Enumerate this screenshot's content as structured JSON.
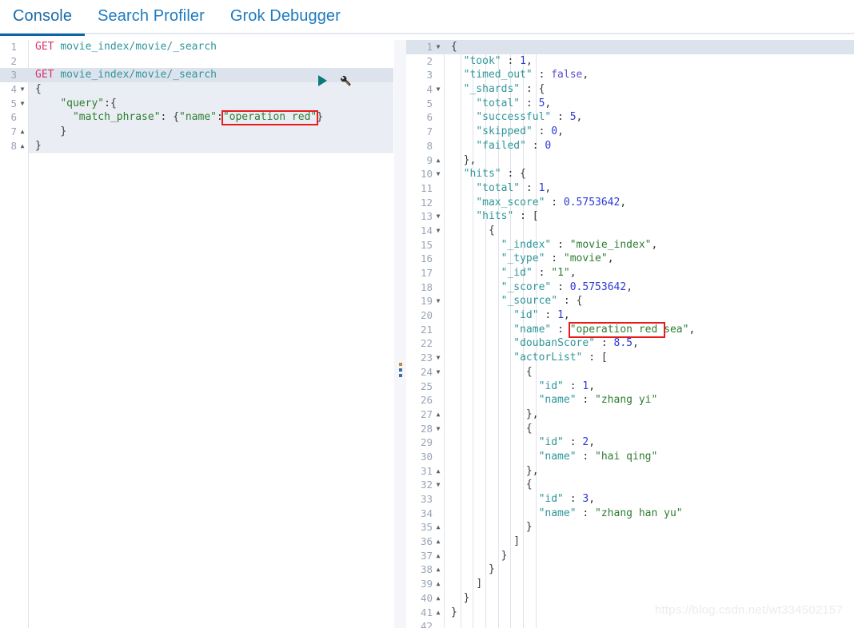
{
  "tabs": [
    {
      "label": "Console",
      "active": true
    },
    {
      "label": "Search Profiler",
      "active": false
    },
    {
      "label": "Grok Debugger",
      "active": false
    }
  ],
  "colors": {
    "accent": "#0b63a8",
    "tab_text": "#1f7bbf",
    "method": "#d6336c",
    "url": "#2f9599",
    "key": "#2f9599",
    "string": "#2e7d32",
    "number": "#2b3ad6",
    "boolean": "#5b4fcf",
    "highlight_line": "#dde3ec",
    "request_block_bg": "#eaeef4",
    "annotation_box": "#e81b1b",
    "watermark": "#ececec"
  },
  "request_editor": {
    "name": "console-request-editor",
    "highlight_line": 3,
    "lines": [
      {
        "n": 1,
        "fold": "",
        "text": "GET movie_index/movie/_search",
        "tokens": [
          {
            "t": "method",
            "v": "GET"
          },
          {
            "t": "punc",
            "v": " "
          },
          {
            "t": "url",
            "v": "movie_index/movie/_search"
          }
        ]
      },
      {
        "n": 2,
        "fold": "",
        "text": "",
        "tokens": []
      },
      {
        "n": 3,
        "fold": "",
        "text": "GET movie_index/movie/_search",
        "tokens": [
          {
            "t": "method",
            "v": "GET"
          },
          {
            "t": "punc",
            "v": " "
          },
          {
            "t": "url",
            "v": "movie_index/movie/_search"
          }
        ]
      },
      {
        "n": 4,
        "fold": "down",
        "text": "{",
        "tokens": [
          {
            "t": "brace",
            "v": "{"
          }
        ]
      },
      {
        "n": 5,
        "fold": "down",
        "text": "    \"query\":{",
        "tokens": [
          {
            "t": "punc",
            "v": "    "
          },
          {
            "t": "str",
            "v": "\"query\""
          },
          {
            "t": "punc",
            "v": ":"
          },
          {
            "t": "brace",
            "v": "{"
          }
        ]
      },
      {
        "n": 6,
        "fold": "",
        "text": "      \"match_phrase\": {\"name\":\"operation red\"}",
        "tokens": [
          {
            "t": "punc",
            "v": "      "
          },
          {
            "t": "str",
            "v": "\"match_phrase\""
          },
          {
            "t": "punc",
            "v": ": "
          },
          {
            "t": "brace",
            "v": "{"
          },
          {
            "t": "str",
            "v": "\"name\""
          },
          {
            "t": "punc",
            "v": ":"
          },
          {
            "t": "str",
            "v": "\"operation red\""
          },
          {
            "t": "brace",
            "v": "}"
          }
        ]
      },
      {
        "n": 7,
        "fold": "up",
        "text": "    }",
        "tokens": [
          {
            "t": "punc",
            "v": "    "
          },
          {
            "t": "brace",
            "v": "}"
          }
        ]
      },
      {
        "n": 8,
        "fold": "up",
        "text": "}",
        "tokens": [
          {
            "t": "brace",
            "v": "}"
          }
        ]
      }
    ],
    "actions": {
      "play_label": "Click to send request",
      "wrench_label": "Open documentation / auto indent"
    },
    "annotation": {
      "text": "operation red"
    }
  },
  "response_editor": {
    "name": "console-response-editor",
    "highlight_line": 1,
    "lines": [
      {
        "n": 1,
        "fold": "down",
        "indent": 0,
        "tokens": [
          {
            "t": "brace",
            "v": "{"
          }
        ]
      },
      {
        "n": 2,
        "fold": "",
        "indent": 1,
        "tokens": [
          {
            "t": "key",
            "v": "\"took\""
          },
          {
            "t": "punc",
            "v": " : "
          },
          {
            "t": "num",
            "v": "1"
          },
          {
            "t": "punc",
            "v": ","
          }
        ]
      },
      {
        "n": 3,
        "fold": "",
        "indent": 1,
        "tokens": [
          {
            "t": "key",
            "v": "\"timed_out\""
          },
          {
            "t": "punc",
            "v": " : "
          },
          {
            "t": "bool",
            "v": "false"
          },
          {
            "t": "punc",
            "v": ","
          }
        ]
      },
      {
        "n": 4,
        "fold": "down",
        "indent": 1,
        "tokens": [
          {
            "t": "key",
            "v": "\"_shards\""
          },
          {
            "t": "punc",
            "v": " : "
          },
          {
            "t": "brace",
            "v": "{"
          }
        ]
      },
      {
        "n": 5,
        "fold": "",
        "indent": 2,
        "tokens": [
          {
            "t": "key",
            "v": "\"total\""
          },
          {
            "t": "punc",
            "v": " : "
          },
          {
            "t": "num",
            "v": "5"
          },
          {
            "t": "punc",
            "v": ","
          }
        ]
      },
      {
        "n": 6,
        "fold": "",
        "indent": 2,
        "tokens": [
          {
            "t": "key",
            "v": "\"successful\""
          },
          {
            "t": "punc",
            "v": " : "
          },
          {
            "t": "num",
            "v": "5"
          },
          {
            "t": "punc",
            "v": ","
          }
        ]
      },
      {
        "n": 7,
        "fold": "",
        "indent": 2,
        "tokens": [
          {
            "t": "key",
            "v": "\"skipped\""
          },
          {
            "t": "punc",
            "v": " : "
          },
          {
            "t": "num",
            "v": "0"
          },
          {
            "t": "punc",
            "v": ","
          }
        ]
      },
      {
        "n": 8,
        "fold": "",
        "indent": 2,
        "tokens": [
          {
            "t": "key",
            "v": "\"failed\""
          },
          {
            "t": "punc",
            "v": " : "
          },
          {
            "t": "num",
            "v": "0"
          }
        ]
      },
      {
        "n": 9,
        "fold": "up",
        "indent": 1,
        "tokens": [
          {
            "t": "brace",
            "v": "}"
          },
          {
            "t": "punc",
            "v": ","
          }
        ]
      },
      {
        "n": 10,
        "fold": "down",
        "indent": 1,
        "tokens": [
          {
            "t": "key",
            "v": "\"hits\""
          },
          {
            "t": "punc",
            "v": " : "
          },
          {
            "t": "brace",
            "v": "{"
          }
        ]
      },
      {
        "n": 11,
        "fold": "",
        "indent": 2,
        "tokens": [
          {
            "t": "key",
            "v": "\"total\""
          },
          {
            "t": "punc",
            "v": " : "
          },
          {
            "t": "num",
            "v": "1"
          },
          {
            "t": "punc",
            "v": ","
          }
        ]
      },
      {
        "n": 12,
        "fold": "",
        "indent": 2,
        "tokens": [
          {
            "t": "key",
            "v": "\"max_score\""
          },
          {
            "t": "punc",
            "v": " : "
          },
          {
            "t": "num",
            "v": "0.5753642"
          },
          {
            "t": "punc",
            "v": ","
          }
        ]
      },
      {
        "n": 13,
        "fold": "down",
        "indent": 2,
        "tokens": [
          {
            "t": "key",
            "v": "\"hits\""
          },
          {
            "t": "punc",
            "v": " : "
          },
          {
            "t": "brace",
            "v": "["
          }
        ]
      },
      {
        "n": 14,
        "fold": "down",
        "indent": 3,
        "tokens": [
          {
            "t": "brace",
            "v": "{"
          }
        ]
      },
      {
        "n": 15,
        "fold": "",
        "indent": 4,
        "tokens": [
          {
            "t": "key",
            "v": "\"_index\""
          },
          {
            "t": "punc",
            "v": " : "
          },
          {
            "t": "str",
            "v": "\"movie_index\""
          },
          {
            "t": "punc",
            "v": ","
          }
        ]
      },
      {
        "n": 16,
        "fold": "",
        "indent": 4,
        "tokens": [
          {
            "t": "key",
            "v": "\"_type\""
          },
          {
            "t": "punc",
            "v": " : "
          },
          {
            "t": "str",
            "v": "\"movie\""
          },
          {
            "t": "punc",
            "v": ","
          }
        ]
      },
      {
        "n": 17,
        "fold": "",
        "indent": 4,
        "tokens": [
          {
            "t": "key",
            "v": "\"_id\""
          },
          {
            "t": "punc",
            "v": " : "
          },
          {
            "t": "str",
            "v": "\"1\""
          },
          {
            "t": "punc",
            "v": ","
          }
        ]
      },
      {
        "n": 18,
        "fold": "",
        "indent": 4,
        "tokens": [
          {
            "t": "key",
            "v": "\"_score\""
          },
          {
            "t": "punc",
            "v": " : "
          },
          {
            "t": "num",
            "v": "0.5753642"
          },
          {
            "t": "punc",
            "v": ","
          }
        ]
      },
      {
        "n": 19,
        "fold": "down",
        "indent": 4,
        "tokens": [
          {
            "t": "key",
            "v": "\"_source\""
          },
          {
            "t": "punc",
            "v": " : "
          },
          {
            "t": "brace",
            "v": "{"
          }
        ]
      },
      {
        "n": 20,
        "fold": "",
        "indent": 5,
        "tokens": [
          {
            "t": "key",
            "v": "\"id\""
          },
          {
            "t": "punc",
            "v": " : "
          },
          {
            "t": "num",
            "v": "1"
          },
          {
            "t": "punc",
            "v": ","
          }
        ]
      },
      {
        "n": 21,
        "fold": "",
        "indent": 5,
        "tokens": [
          {
            "t": "key",
            "v": "\"name\""
          },
          {
            "t": "punc",
            "v": " : "
          },
          {
            "t": "str",
            "v": "\"operation red sea\""
          },
          {
            "t": "punc",
            "v": ","
          }
        ]
      },
      {
        "n": 22,
        "fold": "",
        "indent": 5,
        "tokens": [
          {
            "t": "key",
            "v": "\"doubanScore\""
          },
          {
            "t": "punc",
            "v": " : "
          },
          {
            "t": "num",
            "v": "8.5"
          },
          {
            "t": "punc",
            "v": ","
          }
        ]
      },
      {
        "n": 23,
        "fold": "down",
        "indent": 5,
        "tokens": [
          {
            "t": "key",
            "v": "\"actorList\""
          },
          {
            "t": "punc",
            "v": " : "
          },
          {
            "t": "brace",
            "v": "["
          }
        ]
      },
      {
        "n": 24,
        "fold": "down",
        "indent": 6,
        "tokens": [
          {
            "t": "brace",
            "v": "{"
          }
        ]
      },
      {
        "n": 25,
        "fold": "",
        "indent": 7,
        "tokens": [
          {
            "t": "key",
            "v": "\"id\""
          },
          {
            "t": "punc",
            "v": " : "
          },
          {
            "t": "num",
            "v": "1"
          },
          {
            "t": "punc",
            "v": ","
          }
        ]
      },
      {
        "n": 26,
        "fold": "",
        "indent": 7,
        "tokens": [
          {
            "t": "key",
            "v": "\"name\""
          },
          {
            "t": "punc",
            "v": " : "
          },
          {
            "t": "str",
            "v": "\"zhang yi\""
          }
        ]
      },
      {
        "n": 27,
        "fold": "up",
        "indent": 6,
        "tokens": [
          {
            "t": "brace",
            "v": "}"
          },
          {
            "t": "punc",
            "v": ","
          }
        ]
      },
      {
        "n": 28,
        "fold": "down",
        "indent": 6,
        "tokens": [
          {
            "t": "brace",
            "v": "{"
          }
        ]
      },
      {
        "n": 29,
        "fold": "",
        "indent": 7,
        "tokens": [
          {
            "t": "key",
            "v": "\"id\""
          },
          {
            "t": "punc",
            "v": " : "
          },
          {
            "t": "num",
            "v": "2"
          },
          {
            "t": "punc",
            "v": ","
          }
        ]
      },
      {
        "n": 30,
        "fold": "",
        "indent": 7,
        "tokens": [
          {
            "t": "key",
            "v": "\"name\""
          },
          {
            "t": "punc",
            "v": " : "
          },
          {
            "t": "str",
            "v": "\"hai qing\""
          }
        ]
      },
      {
        "n": 31,
        "fold": "up",
        "indent": 6,
        "tokens": [
          {
            "t": "brace",
            "v": "}"
          },
          {
            "t": "punc",
            "v": ","
          }
        ]
      },
      {
        "n": 32,
        "fold": "down",
        "indent": 6,
        "tokens": [
          {
            "t": "brace",
            "v": "{"
          }
        ]
      },
      {
        "n": 33,
        "fold": "",
        "indent": 7,
        "tokens": [
          {
            "t": "key",
            "v": "\"id\""
          },
          {
            "t": "punc",
            "v": " : "
          },
          {
            "t": "num",
            "v": "3"
          },
          {
            "t": "punc",
            "v": ","
          }
        ]
      },
      {
        "n": 34,
        "fold": "",
        "indent": 7,
        "tokens": [
          {
            "t": "key",
            "v": "\"name\""
          },
          {
            "t": "punc",
            "v": " : "
          },
          {
            "t": "str",
            "v": "\"zhang han yu\""
          }
        ]
      },
      {
        "n": 35,
        "fold": "up",
        "indent": 6,
        "tokens": [
          {
            "t": "brace",
            "v": "}"
          }
        ]
      },
      {
        "n": 36,
        "fold": "up",
        "indent": 5,
        "tokens": [
          {
            "t": "brace",
            "v": "]"
          }
        ]
      },
      {
        "n": 37,
        "fold": "up",
        "indent": 4,
        "tokens": [
          {
            "t": "brace",
            "v": "}"
          }
        ]
      },
      {
        "n": 38,
        "fold": "up",
        "indent": 3,
        "tokens": [
          {
            "t": "brace",
            "v": "}"
          }
        ]
      },
      {
        "n": 39,
        "fold": "up",
        "indent": 2,
        "tokens": [
          {
            "t": "brace",
            "v": "]"
          }
        ]
      },
      {
        "n": 40,
        "fold": "up",
        "indent": 1,
        "tokens": [
          {
            "t": "brace",
            "v": "}"
          }
        ]
      },
      {
        "n": 41,
        "fold": "up",
        "indent": 0,
        "tokens": [
          {
            "t": "brace",
            "v": "}"
          }
        ]
      },
      {
        "n": 42,
        "fold": "",
        "indent": 0,
        "tokens": []
      }
    ],
    "annotation": {
      "text": "operation red "
    }
  },
  "splitter": {
    "label": "drag-to-resize-panels"
  },
  "watermark": {
    "text": "https://blog.csdn.net/wt334502157"
  }
}
